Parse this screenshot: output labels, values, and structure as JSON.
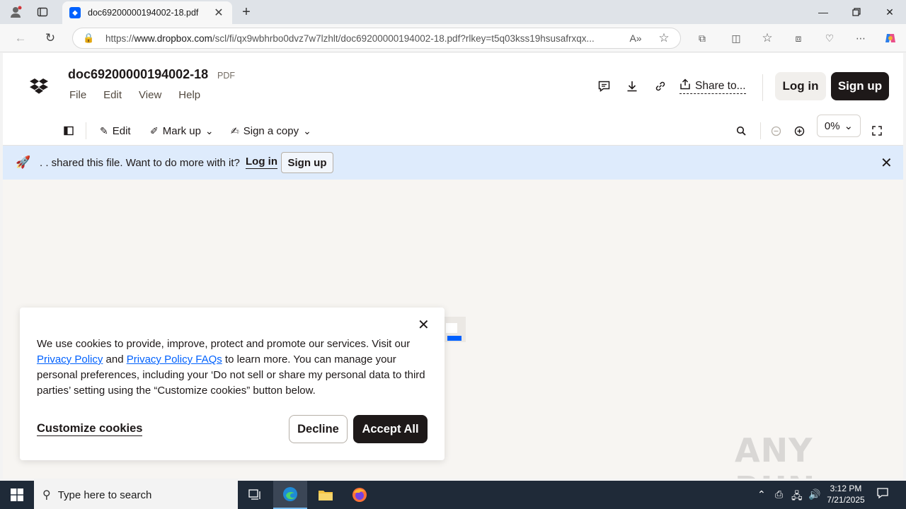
{
  "browser": {
    "tab_title": "doc69200000194002-18.pdf",
    "url_prefix": "https://",
    "url_domain": "www.dropbox.com",
    "url_rest": "/scl/fi/qx9wbhrbo0dvz7w7lzhlt/doc69200000194002-18.pdf?rlkey=t5q03kss19hsusafrxqx..."
  },
  "header": {
    "doc_title": "doc69200000194002-18",
    "doc_type": "PDF",
    "menu": [
      "File",
      "Edit",
      "View",
      "Help"
    ],
    "share_label": "Share to...",
    "login_label": "Log in",
    "signup_label": "Sign up"
  },
  "toolbar": {
    "edit_label": "Edit",
    "markup_label": "Mark up",
    "sign_label": "Sign a copy",
    "zoom_value": "0%"
  },
  "banner": {
    "message": ". . shared this file. Want to do more with it?",
    "login_label": "Log in",
    "signup_label": "Sign up"
  },
  "cookie": {
    "text_1": "We use cookies to provide, improve, protect and promote our services. Visit our ",
    "link_1": "Privacy Policy",
    "text_2": " and ",
    "link_2": "Privacy Policy FAQs",
    "text_3": " to learn more. You can manage your personal preferences, including your ‘Do not sell or share my personal data to third parties’ setting using the “Customize cookies” button below.",
    "customize_label": "Customize cookies",
    "decline_label": "Decline",
    "accept_label": "Accept All"
  },
  "watermark": "ANY RUN",
  "taskbar": {
    "search_placeholder": "Type here to search",
    "time": "3:12 PM",
    "date": "7/21/2025"
  },
  "colors": {
    "accent": "#0061fe",
    "banner_bg": "#deebfc",
    "dark": "#1e1919"
  }
}
